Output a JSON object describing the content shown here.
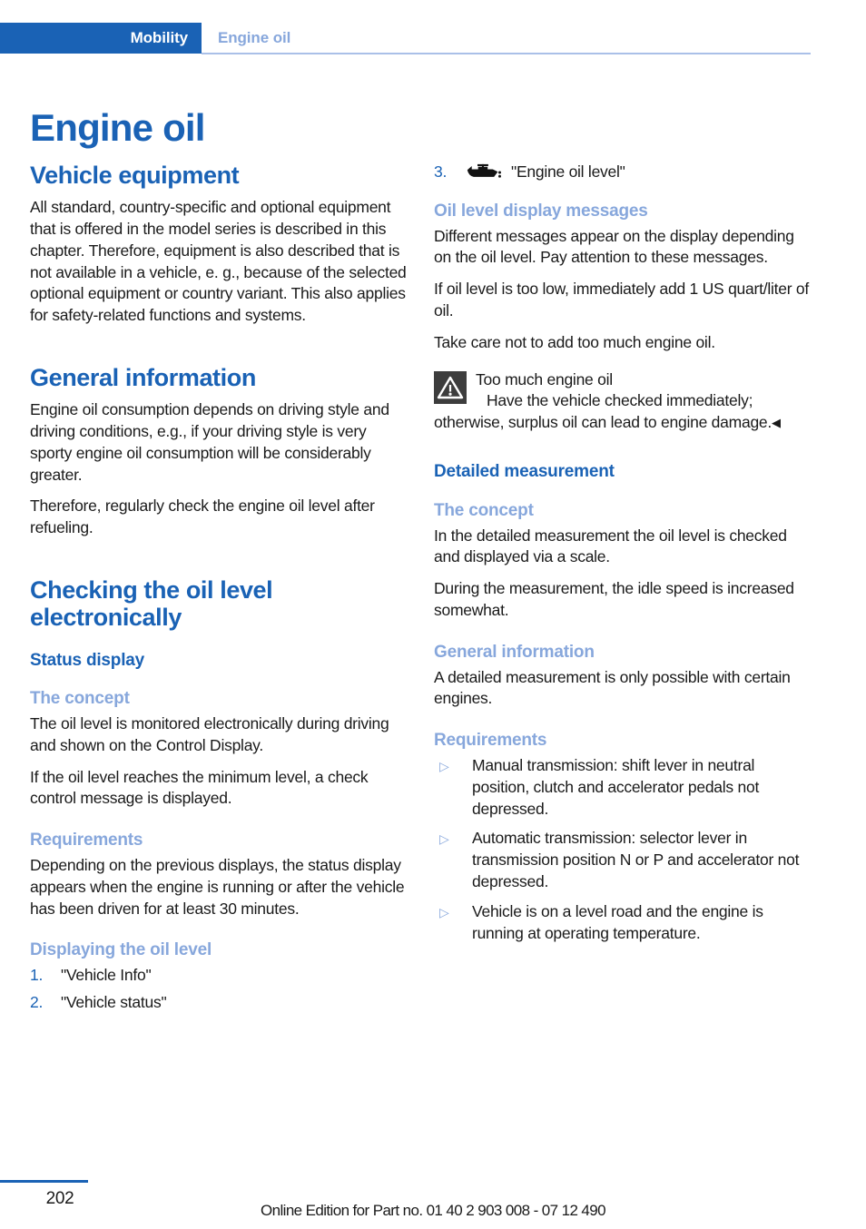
{
  "header": {
    "tab_label": "Mobility",
    "chapter_label": "Engine oil",
    "tab_color": "#1a62b5",
    "chapter_color": "#87a7dc",
    "rule_color": "#aac0e8"
  },
  "page_title": "Engine oil",
  "colors": {
    "heading_primary": "#1a62b5",
    "heading_secondary": "#87a7dc",
    "body_text": "#1a1a1a",
    "warning_box": "#3d3d3d"
  },
  "left_column": {
    "vehicle_equipment": {
      "heading": "Vehicle equipment",
      "paragraphs": [
        "All standard, country-specific and optional equipment that is offered in the model series is described in this chapter. Therefore, equipment is also described that is not available in a vehicle, e. g., because of the selected optional equipment or country variant. This also applies for safety-related functions and systems."
      ]
    },
    "general_information": {
      "heading": "General information",
      "paragraphs": [
        "Engine oil consumption depends on driving style and driving conditions, e.g., if your driving style is very sporty engine oil consumption will be considerably greater.",
        "Therefore, regularly check the engine oil level after refueling."
      ]
    },
    "checking_oil_level": {
      "heading": "Checking the oil level electronically",
      "status_display": {
        "heading": "Status display",
        "concept": {
          "heading": "The concept",
          "paragraphs": [
            "The oil level is monitored electronically during driving and shown on the Control Display.",
            "If the oil level reaches the minimum level, a check control message is displayed."
          ]
        },
        "requirements": {
          "heading": "Requirements",
          "paragraphs": [
            "Depending on the previous displays, the status display appears when the engine is running or after the vehicle has been driven for at least 30 minutes."
          ]
        },
        "displaying": {
          "heading": "Displaying the oil level",
          "steps": [
            {
              "num": "1.",
              "text": "\"Vehicle Info\""
            },
            {
              "num": "2.",
              "text": "\"Vehicle status\""
            }
          ]
        }
      }
    }
  },
  "right_column": {
    "step_three": {
      "num": "3.",
      "icon": "oil-can-icon",
      "text": "\"Engine oil level\""
    },
    "oil_level_display_messages": {
      "heading": "Oil level display messages",
      "paragraphs": [
        "Different messages appear on the display depending on the oil level. Pay attention to these messages.",
        "If oil level is too low, immediately add 1 US quart/liter of oil.",
        "Take care not to add too much engine oil."
      ],
      "warning": {
        "icon": "warning-triangle-icon",
        "title": "Too much engine oil",
        "body": "Have the vehicle checked immediately; otherwise, surplus oil can lead to engine damage.",
        "end_mark": "◀"
      }
    },
    "detailed_measurement": {
      "heading": "Detailed measurement",
      "concept": {
        "heading": "The concept",
        "paragraphs": [
          "In the detailed measurement the oil level is checked and displayed via a scale.",
          "During the measurement, the idle speed is increased somewhat."
        ]
      },
      "general_information": {
        "heading": "General information",
        "paragraphs": [
          "A detailed measurement is only possible with certain engines."
        ]
      },
      "requirements": {
        "heading": "Requirements",
        "bullets": [
          "Manual transmission: shift lever in neutral position, clutch and accelerator pedals not depressed.",
          "Automatic transmission: selector lever in transmission position N or P and accelerator not depressed.",
          "Vehicle is on a level road and the engine is running at operating temperature."
        ],
        "bullet_glyph": "▷"
      }
    }
  },
  "footer": {
    "page_number": "202",
    "edition_text": "Online Edition for Part no. 01 40 2 903 008 - 07 12 490"
  }
}
